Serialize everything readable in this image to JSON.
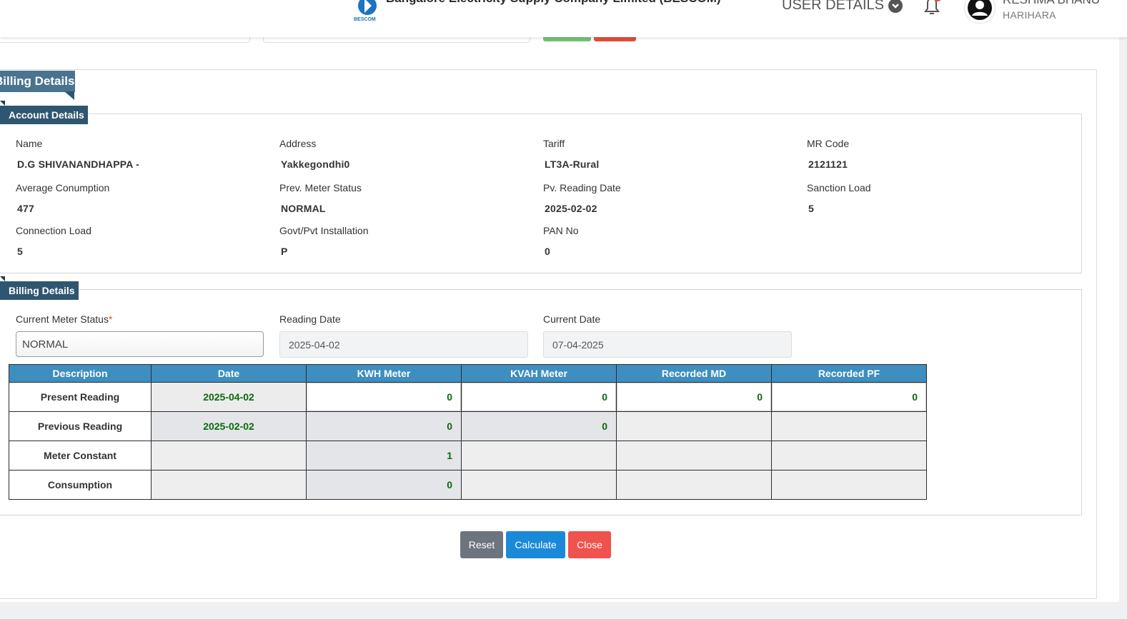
{
  "header": {
    "company_name": "Bangalore Electricity Supply Company Limited (BESCOM)",
    "logo_text": "BESCOM",
    "user_details_label": "USER DETAILS",
    "user_name": "RESHMA BHANU",
    "user_location": "HARIHARA"
  },
  "page": {
    "panel_title": "Billing Details"
  },
  "account_details": {
    "title": "Account Details",
    "fields": [
      {
        "label": "Name",
        "value": "D.G SHIVANANDHAPPA -"
      },
      {
        "label": "Address",
        "value": "Yakkegondhi0"
      },
      {
        "label": "Tariff",
        "value": "LT3A-Rural"
      },
      {
        "label": "MR Code",
        "value": "2121121"
      },
      {
        "label": "Average Conumption",
        "value": "477"
      },
      {
        "label": "Prev. Meter Status",
        "value": "NORMAL"
      },
      {
        "label": "Pv. Reading Date",
        "value": "2025-02-02"
      },
      {
        "label": "Sanction Load",
        "value": "5"
      },
      {
        "label": "Connection Load",
        "value": "5"
      },
      {
        "label": "Govt/Pvt Installation",
        "value": "P"
      },
      {
        "label": "PAN No",
        "value": "0"
      }
    ]
  },
  "billing_details": {
    "title": "Billing Details",
    "current_meter_status_label": "Current Meter Status",
    "required_mark": "*",
    "current_meter_status_value": "NORMAL",
    "reading_date_label": "Reading Date",
    "reading_date_value": "2025-04-02",
    "current_date_label": "Current Date",
    "current_date_value": "07-04-2025"
  },
  "table": {
    "headers": [
      "Description",
      "Date",
      "KWH Meter",
      "KVAH Meter",
      "Recorded MD",
      "Recorded PF"
    ],
    "rows": [
      {
        "desc": "Present Reading",
        "date": "2025-04-02",
        "kwh": "0",
        "kvah": "0",
        "md": "0",
        "pf": "0"
      },
      {
        "desc": "Previous Reading",
        "date": "2025-02-02",
        "kwh": "0",
        "kvah": "0"
      },
      {
        "desc": "Meter Constant",
        "kwh": "1"
      },
      {
        "desc": "Consumption",
        "kwh": "0"
      }
    ]
  },
  "buttons": {
    "reset": "Reset",
    "calculate": "Calculate",
    "close": "Close"
  }
}
